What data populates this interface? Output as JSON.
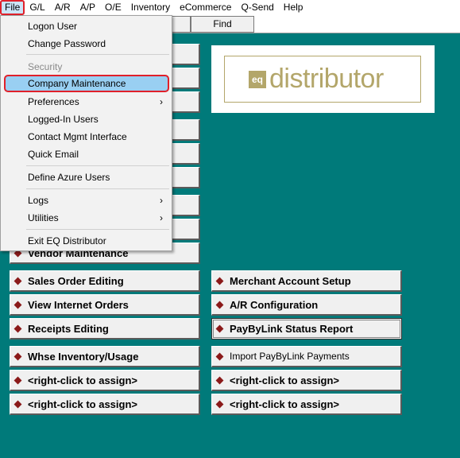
{
  "menubar": {
    "items": [
      "File",
      "G/L",
      "A/R",
      "A/P",
      "O/E",
      "Inventory",
      "eCommerce",
      "Q-Send",
      "Help"
    ]
  },
  "toolbar": {
    "find_label": "Find"
  },
  "file_menu": {
    "items": [
      {
        "label": "Logon User"
      },
      {
        "label": "Change Password"
      },
      {
        "label": "Security",
        "disabled": true
      },
      {
        "label": "Company Maintenance",
        "highlighted": true
      },
      {
        "label": "Preferences",
        "submenu": true
      },
      {
        "label": "Logged-In Users"
      },
      {
        "label": "Contact Mgmt Interface"
      },
      {
        "label": "Quick Email"
      },
      {
        "label": "Define Azure Users"
      },
      {
        "label": "Logs",
        "submenu": true
      },
      {
        "label": "Utilities",
        "submenu": true
      },
      {
        "label": "Exit EQ Distributor"
      }
    ],
    "submenu_arrow": "›"
  },
  "logo": {
    "badge": "eq",
    "text": "distributor",
    "color": "#b3a66a"
  },
  "launcher": {
    "left": [
      "Vendor Maintenance",
      "Sales Order Editing",
      "View Internet Orders",
      "Receipts Editing",
      "Whse Inventory/Usage",
      "<right-click to assign>",
      "<right-click to assign>"
    ],
    "right": [
      "Merchant Account Setup",
      "A/R Configuration",
      "PayByLink Status Report",
      "Import PayByLink Payments",
      "<right-click to assign>",
      "<right-click to assign>"
    ]
  },
  "colors": {
    "workspace": "#007a7a",
    "highlight_outline": "#e0202a",
    "bullet": "#8b1a1a"
  }
}
